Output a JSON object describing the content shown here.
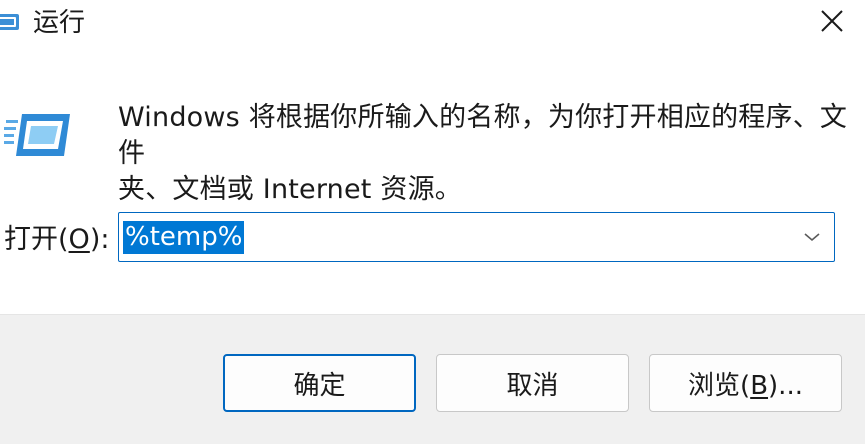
{
  "window": {
    "title": "运行",
    "icon": "run-dialog-icon",
    "close_icon": "close-icon"
  },
  "content": {
    "icon": "run-dialog-icon",
    "description_line1": "Windows 将根据你所输入的名称，为你打开相应的程序、文件",
    "description_line2": "夹、文档或 Internet 资源。"
  },
  "open_field": {
    "label_prefix": "打开(",
    "label_accel": "O",
    "label_suffix": "):",
    "value": "%temp%",
    "value_selected": true,
    "dropdown_icon": "chevron-down-icon"
  },
  "buttons": {
    "ok_label": "确定",
    "cancel_label": "取消",
    "browse_prefix": "浏览(",
    "browse_accel": "B",
    "browse_suffix": ")..."
  },
  "colors": {
    "accent": "#0067c0",
    "selection": "#0078d4",
    "footer_bg": "#f0f0f0"
  }
}
